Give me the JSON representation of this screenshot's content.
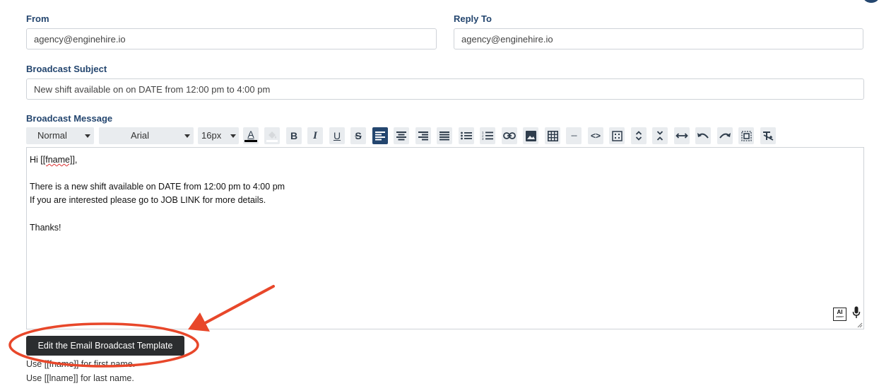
{
  "form": {
    "from": {
      "label": "From",
      "value": "agency@enginehire.io"
    },
    "reply_to": {
      "label": "Reply To",
      "value": "agency@enginehire.io"
    },
    "subject": {
      "label": "Broadcast Subject",
      "value": "New shift available on on DATE from 12:00 pm to 4:00 pm"
    },
    "message": {
      "label": "Broadcast Message"
    }
  },
  "toolbar": {
    "block_format": "Normal",
    "font_family": "Arial",
    "font_size": "16px",
    "buttons": [
      "text-color",
      "highlight",
      "bold",
      "italic",
      "underline",
      "strikethrough",
      "align-left",
      "align-center",
      "align-right",
      "align-justify",
      "bullet-list",
      "numbered-list",
      "link",
      "image",
      "table",
      "horizontal-rule",
      "code-view",
      "select-all",
      "expand-vertical",
      "collapse-vertical",
      "full-width",
      "undo",
      "redo",
      "fullscreen",
      "clear-formatting"
    ],
    "active_button": "align-left",
    "bold_glyph": "B",
    "italic_glyph": "I",
    "underline_glyph": "U",
    "strike_glyph": "S",
    "text_color_glyph": "A",
    "hr_glyph": "---",
    "code_glyph": "<>"
  },
  "editor": {
    "greeting_prefix": "Hi ",
    "greeting_token": "[[fname]]",
    "greeting_suffix": ",",
    "line_2": "There is a new shift available on DATE from 12:00 pm to 4:00 pm",
    "line_3": "If you are interested please go to JOB LINK for more details.",
    "line_4": "Thanks!",
    "ai_badge": "AI",
    "ai_badge_sub": "ASSIST"
  },
  "tooltip": {
    "text": "Edit the Email Broadcast Template"
  },
  "help": {
    "first_name": "Use [[fname]] for first name.",
    "last_name": "Use [[lname]] for last name."
  },
  "colors": {
    "label": "#24466f",
    "annotation": "#e8472a",
    "tooltip_bg": "#2b2d2f"
  }
}
